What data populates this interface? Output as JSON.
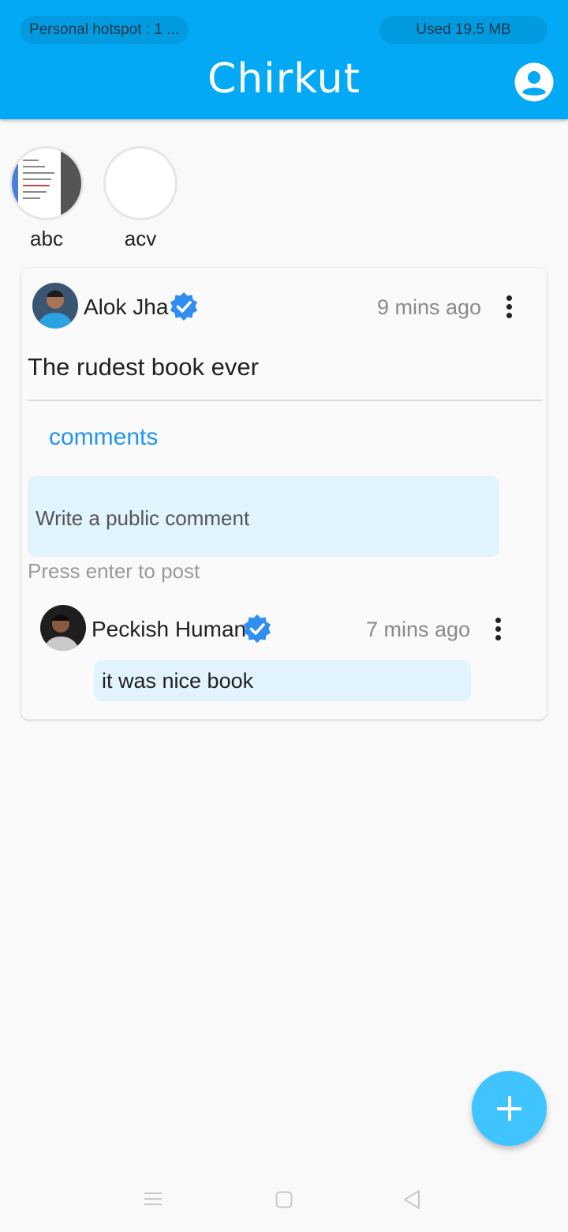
{
  "status_bar": {
    "hotspot": "Personal hotspot : 1 ...",
    "data_used": "Used  19.5 MB"
  },
  "app_bar": {
    "title": "Chirkut",
    "profile_icon": "account-circle-icon"
  },
  "stories": [
    {
      "label": "abc"
    },
    {
      "label": "acv"
    }
  ],
  "post": {
    "author": "Alok Jha",
    "verified": true,
    "time": "9 mins ago",
    "text": "The rudest book ever",
    "comments_label": "comments",
    "comment_placeholder": "Write a public comment",
    "comment_hint": "Press enter to post",
    "comments": [
      {
        "author": "Peckish Human",
        "verified": true,
        "time": "7 mins ago",
        "text": "it was nice book"
      }
    ]
  },
  "fab": {
    "icon": "plus-icon"
  },
  "navigation": {
    "menu_icon": "menu-icon",
    "home_icon": "square-home-icon",
    "back_icon": "triangle-back-icon"
  },
  "colors": {
    "primary": "#03a9f4",
    "accent": "#40c4ff",
    "link": "#2196f3",
    "verified": "#2f8ef0",
    "comment_bg": "#e1f3fd"
  }
}
